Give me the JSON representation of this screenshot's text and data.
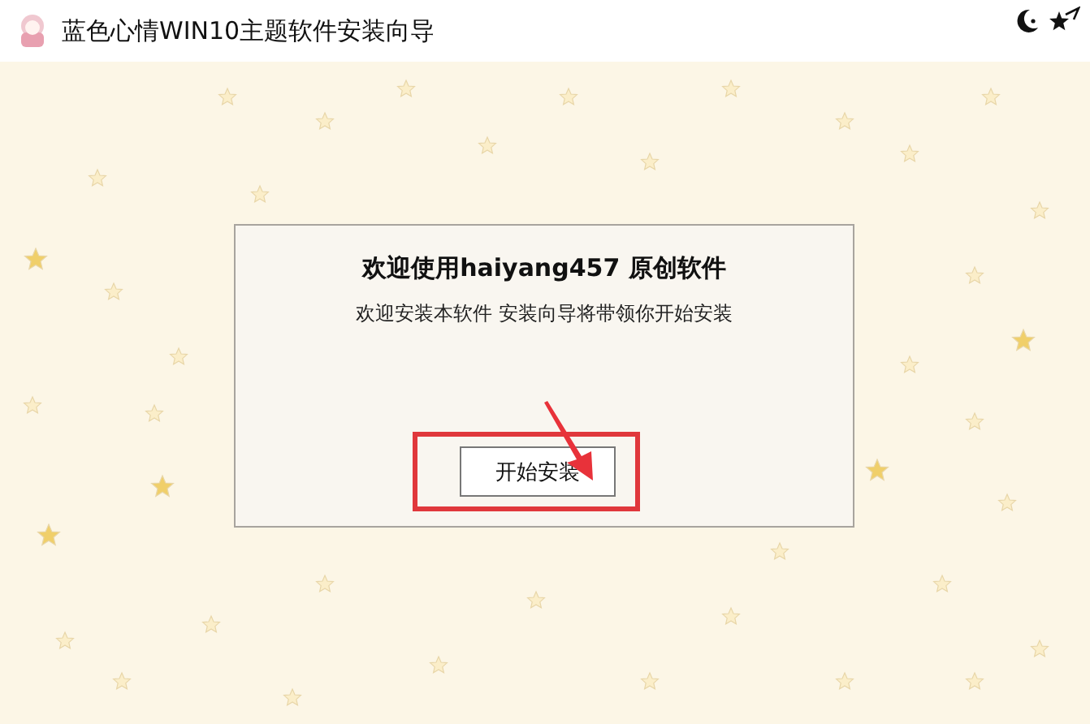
{
  "window": {
    "title": "蓝色心情WIN10主题软件安装向导"
  },
  "dialog": {
    "heading": "欢迎使用haiyang457 原创软件",
    "message": "欢迎安装本软件 安装向导将带领你开始安装",
    "button": "开始安装"
  }
}
